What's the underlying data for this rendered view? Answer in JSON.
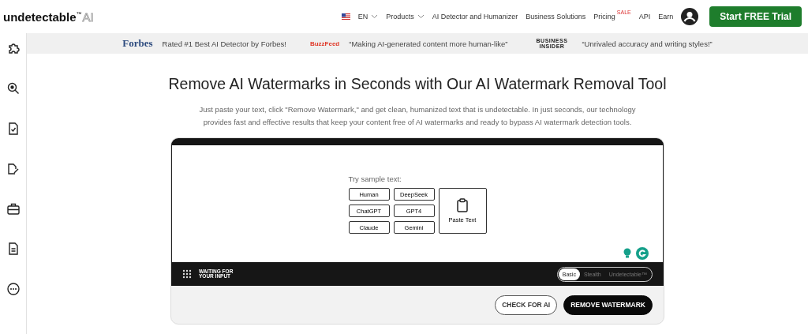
{
  "header": {
    "logo": {
      "name": "undetectable",
      "mark": "™",
      "suffix": "AI"
    },
    "language": {
      "label": "EN"
    },
    "nav": [
      {
        "label": "Products",
        "kind": "dropdown"
      },
      {
        "label": "AI Detector and Humanizer",
        "kind": "link"
      },
      {
        "label": "Business Solutions",
        "kind": "link"
      },
      {
        "label": "Pricing",
        "kind": "link",
        "badge": "SALE"
      },
      {
        "label": "API",
        "kind": "link"
      },
      {
        "label": "Earn",
        "kind": "link"
      }
    ],
    "cta": "Start FREE Trial"
  },
  "sidebar": {
    "items": [
      {
        "kind": "puzzle"
      },
      {
        "kind": "zoom"
      },
      {
        "kind": "doc-check"
      },
      {
        "kind": "doc-pen"
      },
      {
        "kind": "briefcase"
      },
      {
        "kind": "doc-lines"
      },
      {
        "kind": "more"
      }
    ]
  },
  "press": [
    {
      "logo": "Forbes",
      "kind": "forbes",
      "quote": "Rated #1 Best AI Detector by Forbes!"
    },
    {
      "logo": "BuzzFeed",
      "kind": "buzzfeed",
      "quote": "“Making AI-generated content more human-like”"
    },
    {
      "logo": "BUSINESS INSIDER",
      "kind": "insider",
      "quote": "“Unrivaled accuracy and writing styles!”"
    }
  ],
  "hero": {
    "title": "Remove AI Watermarks in Seconds with Our AI Watermark Removal Tool",
    "description": "Just paste your text, click \"Remove Watermark,\" and get clean, humanized text that is undetectable. In just seconds, our technology provides fast and effective results that keep your content free of AI watermarks and ready to bypass AI watermark detection tools."
  },
  "editor": {
    "sample_label": "Try sample text:",
    "samples": [
      "Human",
      "DeepSeek",
      "ChatGPT",
      "GPT4",
      "Claude",
      "Gemini"
    ],
    "paste": "Paste Text",
    "status": "WAITING FOR YOUR INPUT",
    "modes": [
      {
        "label": "Basic",
        "selected": true
      },
      {
        "label": "Stealth",
        "selected": false
      },
      {
        "label": "Undetectable™",
        "selected": false
      }
    ],
    "buttons": [
      {
        "label": "CHECK FOR AI",
        "kind": "outline"
      },
      {
        "label": "REMOVE WATERMARK",
        "kind": "primary"
      }
    ]
  }
}
